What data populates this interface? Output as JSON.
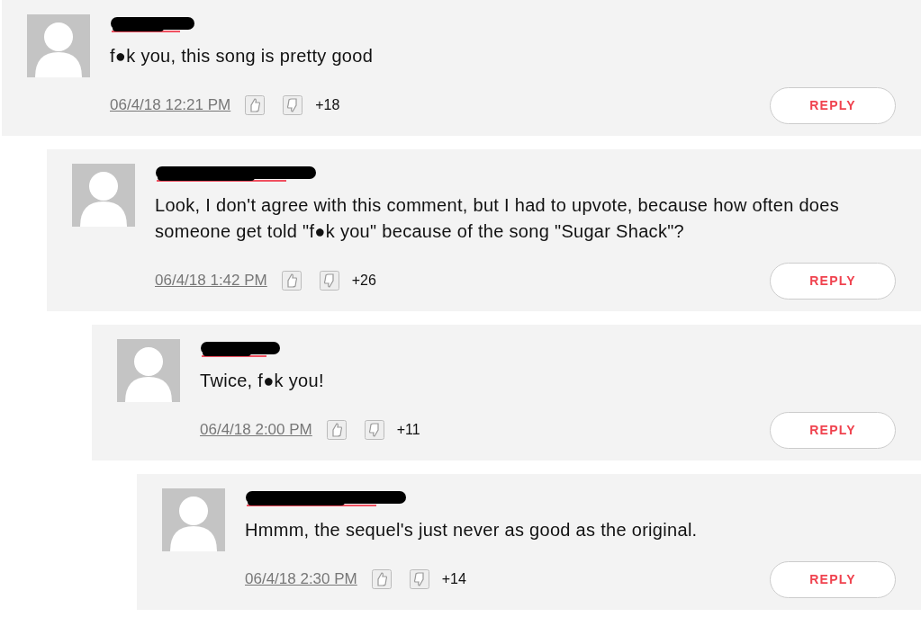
{
  "comments": [
    {
      "text": "f●k you, this song is pretty good",
      "date": "06/4/18 12:21 PM",
      "score": "+18",
      "reply": "REPLY",
      "children": [
        {
          "text": "Look, I don't agree with this comment, but I had to upvote, because how often does someone get told \"f●k you\" because of the song \"Sugar Shack\"?",
          "date": "06/4/18 1:42 PM",
          "score": "+26",
          "reply": "REPLY",
          "children": [
            {
              "text": "Twice, f●k you!",
              "date": "06/4/18 2:00 PM",
              "score": "+11",
              "reply": "REPLY",
              "children": [
                {
                  "text": "Hmmm, the sequel's just never as good as the original.",
                  "date": "06/4/18 2:30 PM",
                  "score": "+14",
                  "reply": "REPLY"
                }
              ]
            }
          ]
        }
      ]
    }
  ]
}
